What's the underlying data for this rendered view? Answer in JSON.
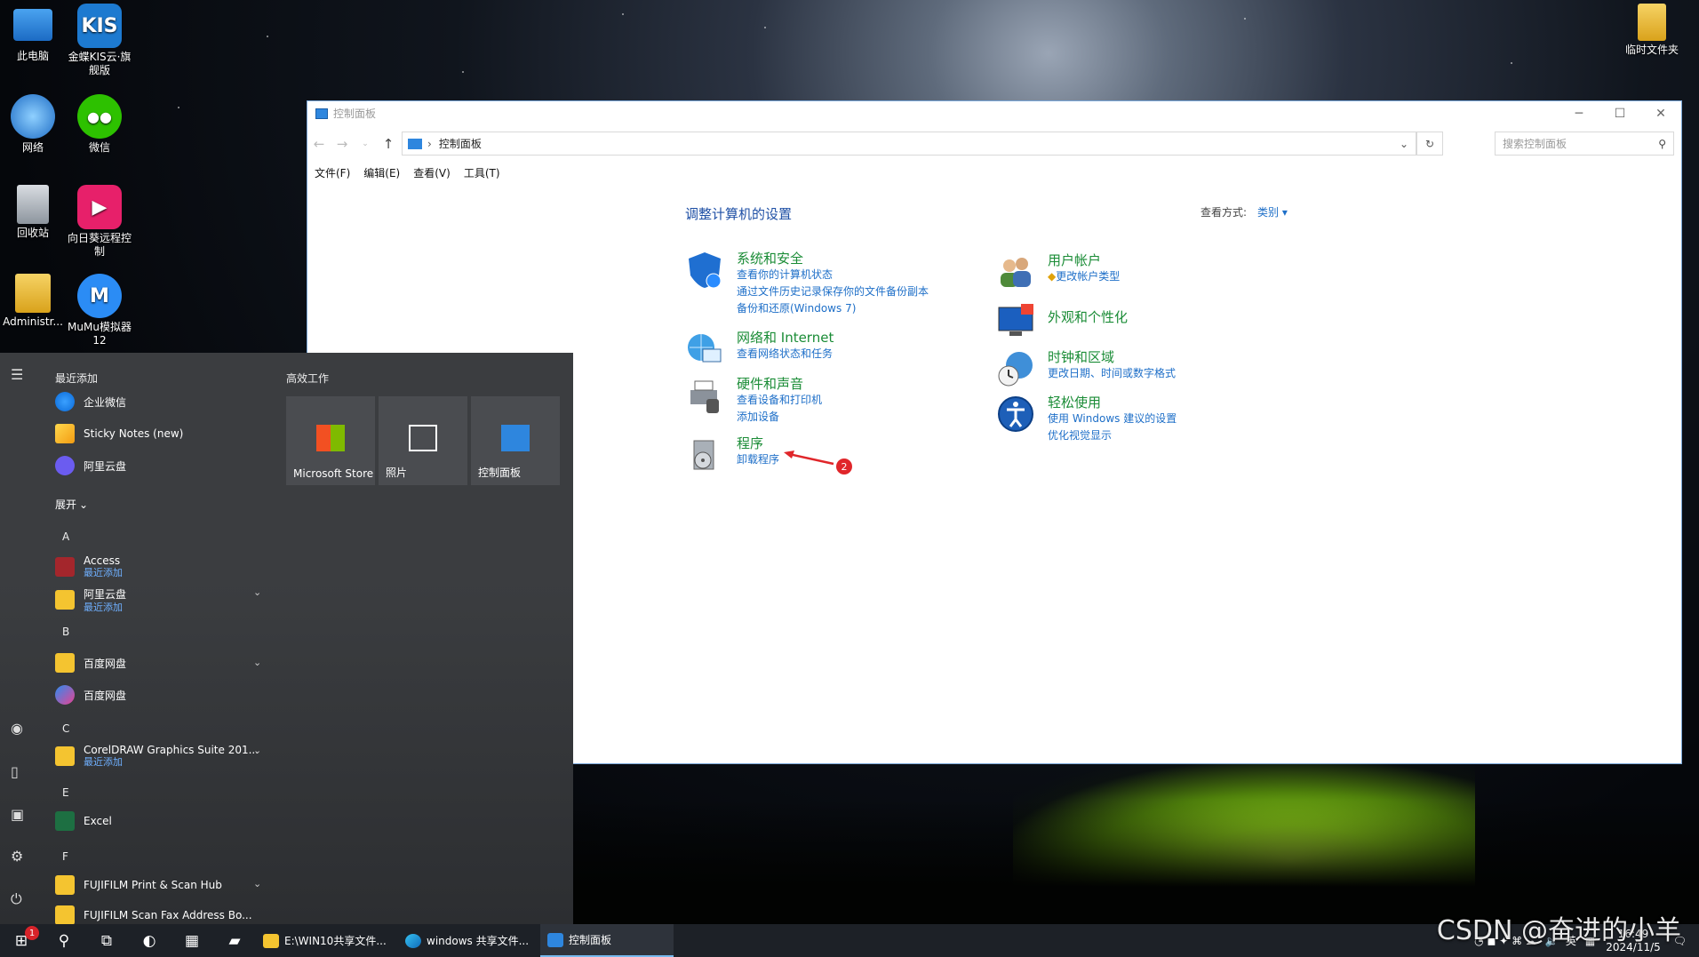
{
  "desktop": {
    "left_icons": [
      {
        "label": "此电脑",
        "icon": "computer-icon"
      },
      {
        "label": "金蝶KIS云·旗舰版",
        "icon": "kis-icon"
      },
      {
        "label": "网络",
        "icon": "network-icon"
      },
      {
        "label": "微信",
        "icon": "wechat-icon"
      },
      {
        "label": "回收站",
        "icon": "recycle-bin-icon"
      },
      {
        "label": "向日葵远程控制",
        "icon": "sunlogin-icon"
      },
      {
        "label": "Administr...",
        "icon": "user-folder-icon"
      },
      {
        "label": "MuMu模拟器12",
        "icon": "mumu-icon"
      }
    ],
    "right_icon": {
      "label": "临时文件夹",
      "icon": "folder-icon"
    }
  },
  "control_panel": {
    "window_title": "控制面板",
    "breadcrumb": "控制面板",
    "search_placeholder": "搜索控制面板",
    "menu": [
      "文件(F)",
      "编辑(E)",
      "查看(V)",
      "工具(T)"
    ],
    "heading": "调整计算机的设置",
    "view_by_label": "查看方式:",
    "view_by_value": "类别",
    "categories_left": [
      {
        "title": "系统和安全",
        "links": [
          "查看你的计算机状态",
          "通过文件历史记录保存你的文件备份副本",
          "备份和还原(Windows 7)"
        ],
        "icon": "shield-icon"
      },
      {
        "title": "网络和 Internet",
        "links": [
          "查看网络状态和任务"
        ],
        "icon": "globe-network-icon"
      },
      {
        "title": "硬件和声音",
        "links": [
          "查看设备和打印机",
          "添加设备"
        ],
        "icon": "printer-icon"
      },
      {
        "title": "程序",
        "links": [
          "卸载程序"
        ],
        "icon": "programs-icon"
      }
    ],
    "categories_right": [
      {
        "title": "用户帐户",
        "links": [
          "更改帐户类型"
        ],
        "icon": "users-icon"
      },
      {
        "title": "外观和个性化",
        "links": [],
        "icon": "monitor-icon"
      },
      {
        "title": "时钟和区域",
        "links": [
          "更改日期、时间或数字格式"
        ],
        "icon": "clock-globe-icon"
      },
      {
        "title": "轻松使用",
        "links": [
          "使用 Windows 建议的设置",
          "优化视觉显示"
        ],
        "icon": "ease-of-access-icon"
      }
    ],
    "annotation_number": "2",
    "accent_color": "#1e6fc8",
    "heading_color": "#1a8c36"
  },
  "start_menu": {
    "recent_heading": "最近添加",
    "recent": [
      "企业微信",
      "Sticky Notes (new)",
      "阿里云盘"
    ],
    "expand_label": "展开",
    "groups": [
      {
        "letter": "A",
        "apps": [
          {
            "name": "Access",
            "sub": "最近添加"
          },
          {
            "name": "阿里云盘",
            "sub": "最近添加"
          }
        ]
      },
      {
        "letter": "B",
        "apps": [
          {
            "name": "百度网盘",
            "sub": ""
          },
          {
            "name": "百度网盘",
            "sub": ""
          }
        ]
      },
      {
        "letter": "C",
        "apps": [
          {
            "name": "CorelDRAW Graphics Suite 201...",
            "sub": "最近添加"
          }
        ]
      },
      {
        "letter": "E",
        "apps": [
          {
            "name": "Excel",
            "sub": ""
          }
        ]
      },
      {
        "letter": "F",
        "apps": [
          {
            "name": "FUJIFILM Print & Scan Hub",
            "sub": ""
          },
          {
            "name": "FUJIFILM Scan Fax Address Bo...",
            "sub": ""
          }
        ]
      }
    ],
    "tiles_heading": "高效工作",
    "tiles": [
      "Microsoft Store",
      "照片",
      "控制面板"
    ]
  },
  "taskbar": {
    "start_badge": "1",
    "apps": [
      {
        "label": "E:\\WIN10共享文件...",
        "icon": "folder-icon"
      },
      {
        "label": "windows 共享文件...",
        "icon": "edge-icon"
      },
      {
        "label": "控制面板",
        "icon": "control-panel-icon"
      }
    ],
    "tray_time": "16:49",
    "tray_date": "2024/11/5",
    "tray_lang": "英"
  },
  "watermark": "CSDN @奋进的小羊"
}
